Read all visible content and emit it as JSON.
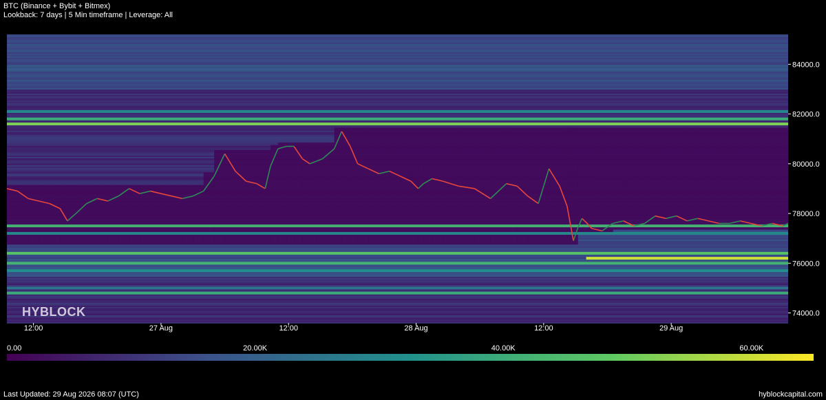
{
  "header": {
    "title": "BTC (Binance + Bybit + Bitmex)",
    "subtitle": "Lookback: 7 days | 5 Min timeframe | Leverage: All"
  },
  "watermark": "HYBLOCK",
  "footer": {
    "last_updated": "Last Updated: 29 Aug 2026 08:07 (UTC)",
    "site": "hyblockcapital.com"
  },
  "colors": {
    "background": "#000000",
    "price_up": "#2e8b57",
    "price_down": "#e8473a",
    "colormap": [
      "#440154",
      "#3b528b",
      "#21918c",
      "#5ec962",
      "#fde725"
    ]
  },
  "colorbar": {
    "ticks": [
      "0.00",
      "20.00K",
      "40.00K",
      "60.00K"
    ],
    "tick_values": [
      0,
      20000,
      40000,
      60000
    ],
    "max": 65000
  },
  "chart_data": {
    "type": "heatmap",
    "title": "BTC (Binance + Bybit + Bitmex)",
    "subtitle": "Lookback: 7 days | 5 Min timeframe | Leverage: All",
    "x_tick_labels": [
      "12:00",
      "27 Aug",
      "12:00",
      "28 Aug",
      "12:00",
      "29 Aug"
    ],
    "x_tick_hours": [
      12,
      24,
      36,
      48,
      60,
      72
    ],
    "x_range_hours": [
      9.5,
      83
    ],
    "y_tick_labels": [
      "74000.0",
      "76000.0",
      "78000.0",
      "80000.0",
      "82000.0",
      "84000.0"
    ],
    "y_tick_values": [
      74000,
      76000,
      78000,
      80000,
      82000,
      84000
    ],
    "ylim": [
      73600,
      85200
    ],
    "price_series": {
      "name": "BTC",
      "x_hours": [
        9.5,
        10.5,
        11.5,
        12.5,
        13.5,
        14.5,
        15.2,
        16,
        17,
        18,
        19,
        20,
        21,
        22,
        23,
        24,
        25,
        26,
        27,
        28,
        29,
        30,
        31,
        32,
        33,
        33.8,
        34.3,
        35,
        35.8,
        36.5,
        37.3,
        38,
        38.6,
        39.2,
        40.3,
        41,
        41.8,
        42.5,
        43.5,
        44.5,
        45.5,
        46.5,
        47.5,
        48.2,
        48.7,
        49.5,
        50.5,
        52,
        53.5,
        55,
        56.5,
        57.5,
        58.5,
        59.5,
        60.5,
        61.5,
        62.2,
        62.5,
        62.8,
        63.2,
        63.6,
        64.1,
        64.5,
        65.5,
        66.5,
        67.5,
        68.5,
        69.5,
        70.5,
        71.5,
        72.5,
        73.5,
        74.5,
        75.5,
        76.5,
        77.5,
        78.5,
        79.5,
        80.5,
        81.5,
        82.5,
        83
      ],
      "price": [
        79000,
        78900,
        78600,
        78500,
        78400,
        78200,
        77700,
        78000,
        78400,
        78600,
        78500,
        78700,
        79000,
        78800,
        78900,
        78800,
        78700,
        78600,
        78700,
        78900,
        79500,
        80400,
        79700,
        79300,
        79200,
        79000,
        79900,
        80600,
        80700,
        80700,
        80200,
        80000,
        80100,
        80200,
        80600,
        81300,
        80700,
        80000,
        79800,
        79600,
        79700,
        79500,
        79300,
        79000,
        79200,
        79400,
        79300,
        79100,
        79000,
        78600,
        79200,
        79100,
        78700,
        78400,
        79800,
        79100,
        78300,
        77600,
        76900,
        77400,
        77800,
        77600,
        77400,
        77300,
        77600,
        77700,
        77500,
        77600,
        77900,
        77800,
        77900,
        77700,
        77800,
        77700,
        77600,
        77600,
        77700,
        77600,
        77500,
        77600,
        77500,
        77600
      ]
    },
    "liquidation_bands": [
      {
        "price": 81600,
        "value": 52000,
        "from_hours": 9.5,
        "to_hours": 83
      },
      {
        "price": 81800,
        "value": 40000,
        "from_hours": 9.5,
        "to_hours": 83
      },
      {
        "price": 82100,
        "value": 30000,
        "from_hours": 9.5,
        "to_hours": 83
      },
      {
        "price": 77500,
        "value": 42000,
        "from_hours": 9.5,
        "to_hours": 83
      },
      {
        "price": 77200,
        "value": 30000,
        "from_hours": 9.5,
        "to_hours": 83
      },
      {
        "price": 76400,
        "value": 47000,
        "from_hours": 9.5,
        "to_hours": 83
      },
      {
        "price": 76200,
        "value": 60000,
        "from_hours": 64,
        "to_hours": 83
      },
      {
        "price": 76000,
        "value": 42000,
        "from_hours": 9.5,
        "to_hours": 83
      },
      {
        "price": 75700,
        "value": 32000,
        "from_hours": 9.5,
        "to_hours": 83
      },
      {
        "price": 75000,
        "value": 25000,
        "from_hours": 9.5,
        "to_hours": 83
      },
      {
        "price": 74800,
        "value": 40000,
        "from_hours": 9.5,
        "to_hours": 83
      },
      {
        "price": 83800,
        "value": 18000,
        "from_hours": 9.5,
        "to_hours": 83
      },
      {
        "price": 84700,
        "value": 15000,
        "from_hours": 9.5,
        "to_hours": 83
      }
    ],
    "colorbar_label_ticks": [
      0,
      20000,
      40000,
      60000
    ],
    "legend": "bottom colorbar"
  }
}
